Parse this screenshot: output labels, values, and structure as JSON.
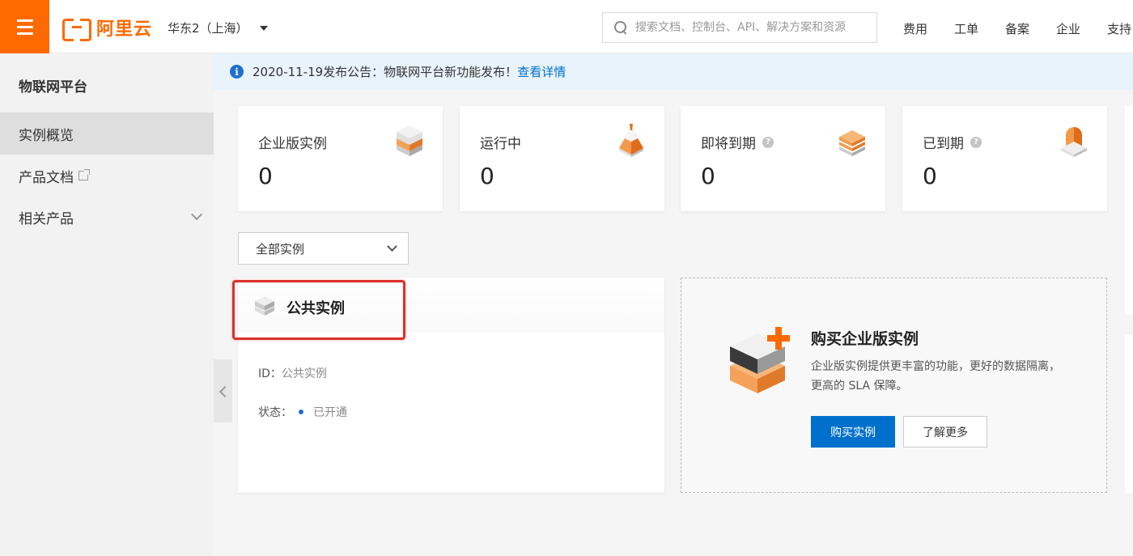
{
  "header": {
    "brand": "阿里云",
    "region": "华东2（上海）",
    "search_placeholder": "搜索文档、控制台、API、解决方案和资源",
    "nav": [
      "费用",
      "工单",
      "备案",
      "企业",
      "支持"
    ]
  },
  "sidebar": {
    "title": "物联网平台",
    "items": [
      {
        "label": "实例概览",
        "active": true
      },
      {
        "label": "产品文档",
        "external": true
      },
      {
        "label": "相关产品",
        "expandable": true
      }
    ]
  },
  "notice": {
    "text": "2020-11-19发布公告：物联网平台新功能发布！",
    "link": "查看详情"
  },
  "stats": [
    {
      "label": "企业版实例",
      "value": "0",
      "icon": "stack-icon"
    },
    {
      "label": "运行中",
      "value": "0",
      "icon": "pyramid-icon"
    },
    {
      "label": "即将到期",
      "value": "0",
      "icon": "layers-icon",
      "help": true
    },
    {
      "label": "已到期",
      "value": "0",
      "icon": "alarm-icon",
      "help": true
    }
  ],
  "filter": {
    "selected": "全部实例"
  },
  "instance": {
    "title": "公共实例",
    "id_label": "ID：",
    "id_value": "公共实例",
    "status_label": "状态：",
    "status_value": "已开通"
  },
  "promo": {
    "title": "购买企业版实例",
    "desc": "企业版实例提供更丰富的功能，更好的数据隔离，更高的 SLA 保障。",
    "buy_label": "购买实例",
    "more_label": "了解更多"
  },
  "colors": {
    "brand": "#ff6a00",
    "primary": "#0070cc",
    "highlight": "#d9322b"
  }
}
